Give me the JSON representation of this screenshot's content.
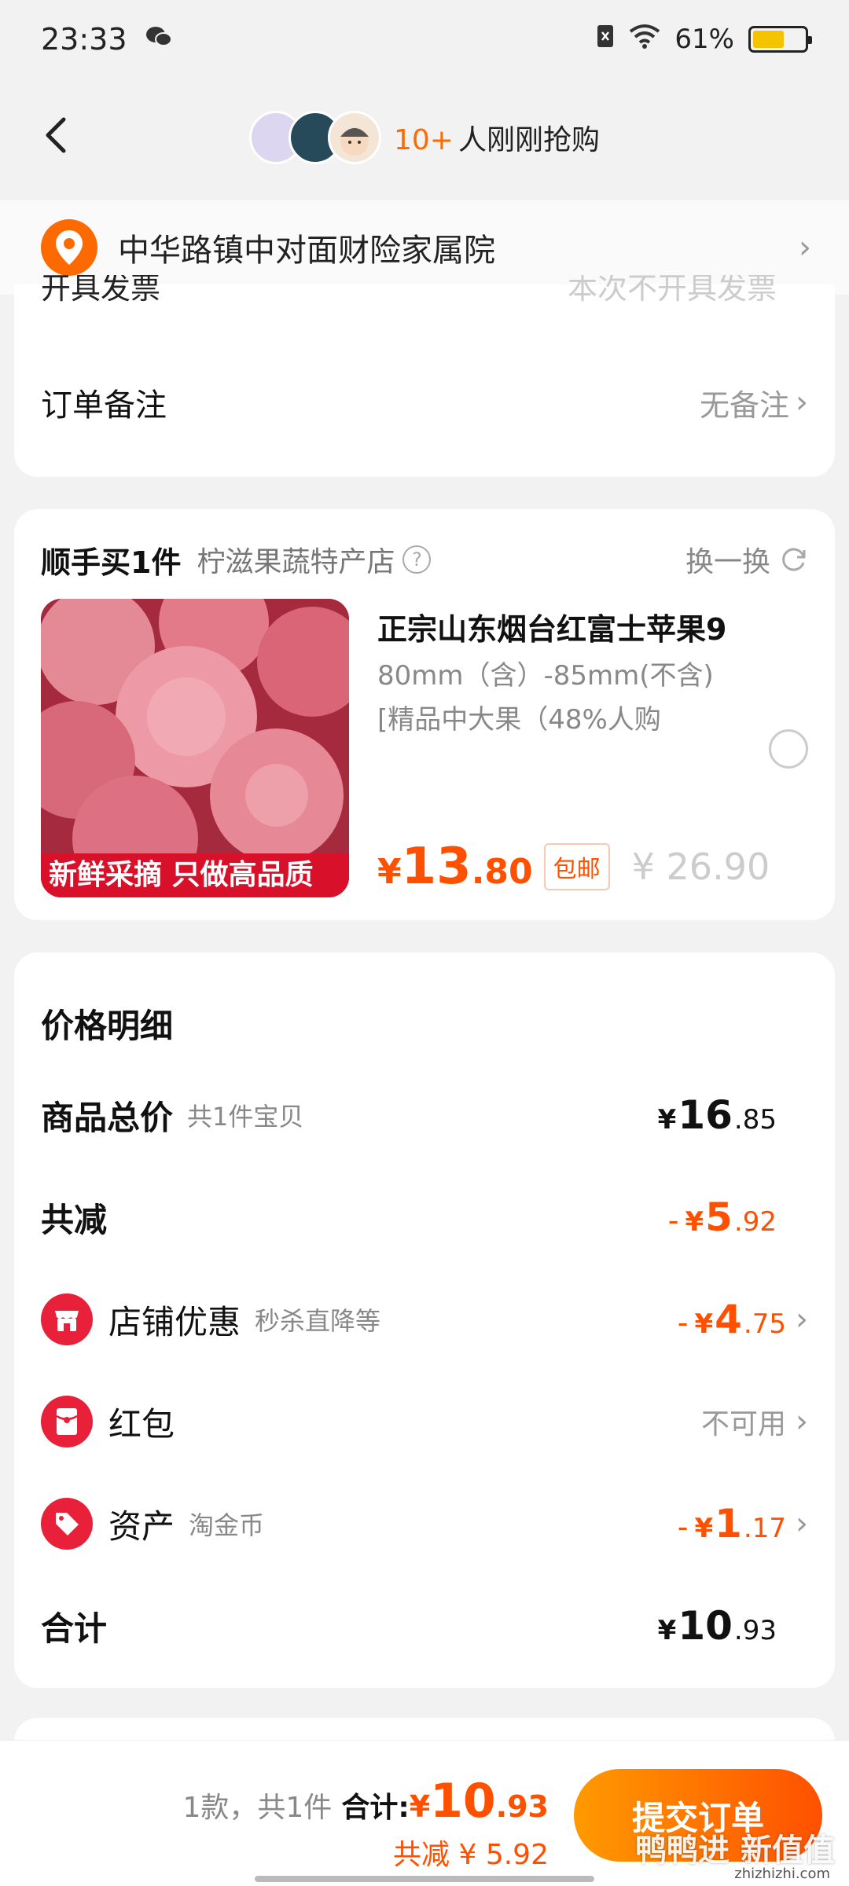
{
  "status_bar": {
    "time": "23:33",
    "battery_text": "61%",
    "battery_level": 0.61
  },
  "header": {
    "buyers_count": "10+",
    "buyers_text": "人刚刚抢购"
  },
  "address": {
    "text": "中华路镇中对面财险家属院"
  },
  "invoice_row": {
    "label": "开具发票",
    "value": "本次不开具发票"
  },
  "remark_row": {
    "label": "订单备注",
    "value": "无备注"
  },
  "addon": {
    "title": "顺手买1件",
    "shop": "柠滋果蔬特产店",
    "swap_label": "换一换",
    "product": {
      "title": "正宗山东烟台红富士苹果9",
      "spec1": "80mm（含）-85mm(不含)",
      "spec2": "[精品中大果（48%人购",
      "banner": "新鲜采摘 只做高品质",
      "price_yen": "¥",
      "price_int": "13",
      "price_dec": ".80",
      "free_shipping": "包邮",
      "original_price": "¥ 26.90"
    }
  },
  "price_detail": {
    "title": "价格明细",
    "goods_total": {
      "label": "商品总价",
      "sub": "共1件宝贝",
      "yen": "¥",
      "int": "16",
      "dec": ".85"
    },
    "total_reduction": {
      "label": "共减",
      "minus": "-",
      "yen": "¥",
      "int": "5",
      "dec": ".92"
    },
    "store_discount": {
      "label": "店铺优惠",
      "sub": "秒杀直降等",
      "minus": "-",
      "yen": "¥",
      "int": "4",
      "dec": ".75"
    },
    "red_packet": {
      "label": "红包",
      "value": "不可用"
    },
    "assets": {
      "label": "资产",
      "sub": "淘金币",
      "minus": "-",
      "yen": "¥",
      "int": "1",
      "dec": ".17"
    },
    "sum": {
      "label": "合计",
      "yen": "¥",
      "int": "10",
      "dec": ".93"
    }
  },
  "bottom_bar": {
    "count_text": "1款，共1件",
    "total_label": "合计:",
    "total_yen": "¥",
    "total_int": "10",
    "total_dec": ".93",
    "saved_text": "共减 ¥ 5.92",
    "submit_label": "提交订单"
  },
  "watermark": {
    "text": "鸭鸭进 新值值",
    "sub": "zhizhizhi.com"
  },
  "colors": {
    "accent": "#ff5000",
    "brand_red": "#e8203a",
    "background": "#f2f2f2"
  }
}
